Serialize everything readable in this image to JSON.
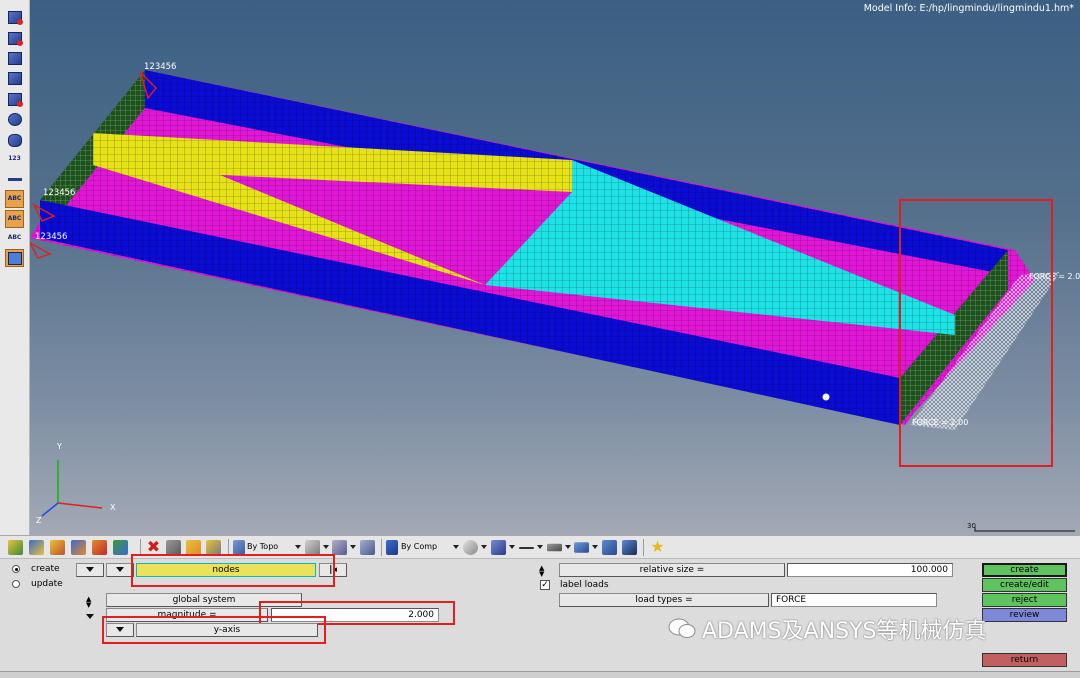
{
  "window": {
    "model_info": "Model Info: E:/hp/lingmindu/lingmindu1.hm*"
  },
  "viewport": {
    "constraint_labels": [
      "123456",
      "123456",
      "123456"
    ],
    "force_labels": [
      "FORCE = 2.0",
      "FORCE = 2.00"
    ],
    "axis_labels": {
      "x": "X",
      "y": "Y",
      "z": "Z"
    },
    "scale_label": "30",
    "colors": {
      "magenta": "#e216d6",
      "blue": "#0b0bd6",
      "yellow": "#e6e215",
      "cyan": "#1ee3e6",
      "dark_green": "#1f4f1f"
    }
  },
  "left_toolbar": {
    "text_icons": [
      "123",
      "ABC",
      "ABC",
      "ABC"
    ]
  },
  "toolbar": {
    "by_topo": "By Topo",
    "by_comp": "By Comp"
  },
  "panel": {
    "create_label": "create",
    "update_label": "update",
    "selector": "nodes",
    "system": "global system",
    "magnitude_label": "magnitude =",
    "magnitude_value": "2.000",
    "direction": "y-axis",
    "relative_size_label": "relative size =",
    "relative_size_value": "100.000",
    "label_loads": "label loads",
    "load_types_label": "load types =",
    "load_types_value": "FORCE",
    "commands": {
      "create": "create",
      "create_edit": "create/edit",
      "reject": "reject",
      "review": "review",
      "return": "return"
    },
    "colors": {
      "create": "#5fc35f",
      "create_edit": "#5fc35f",
      "reject": "#5fc35f",
      "review": "#7e88d8",
      "return": "#c06060",
      "selector": "#e9e25a"
    }
  },
  "watermark": "ADAMS及ANSYS等机械仿真"
}
